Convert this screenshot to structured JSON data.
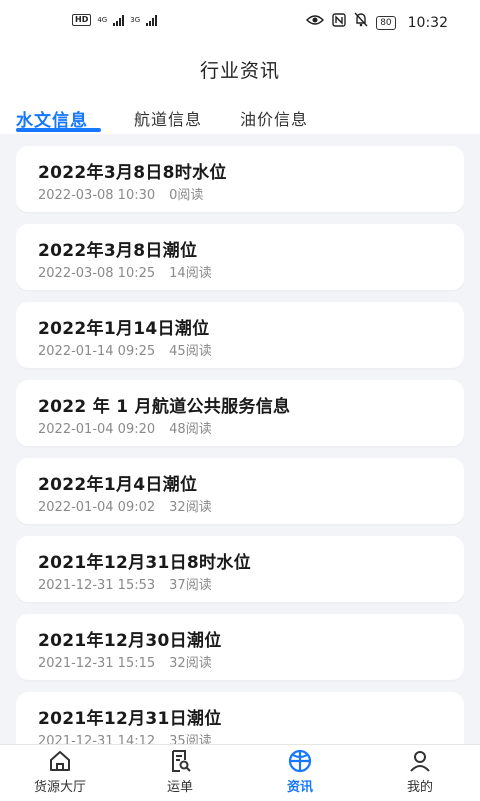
{
  "status_bar": {
    "hd": "HD",
    "net1": "4G",
    "net2": "3G",
    "battery": "80",
    "time": "10:32"
  },
  "header": {
    "title": "行业资讯",
    "tabs": [
      "水文信息",
      "航道信息",
      "油价信息"
    ],
    "active_tab": 0,
    "accent_color": "#1677ff"
  },
  "articles": [
    {
      "title": "2022年3月8日8时水位",
      "time": "2022-03-08 10:30",
      "reads": "0阅读"
    },
    {
      "title": "2022年3月8日潮位",
      "time": "2022-03-08 10:25",
      "reads": "14阅读"
    },
    {
      "title": "2022年1月14日潮位",
      "time": "2022-01-14 09:25",
      "reads": "45阅读"
    },
    {
      "title": "2022 年 1 月航道公共服务信息",
      "time": "2022-01-04 09:20",
      "reads": "48阅读"
    },
    {
      "title": "2022年1月4日潮位",
      "time": "2022-01-04 09:02",
      "reads": "32阅读"
    },
    {
      "title": "2021年12月31日8时水位",
      "time": "2021-12-31 15:53",
      "reads": "37阅读"
    },
    {
      "title": "2021年12月30日潮位",
      "time": "2021-12-31 15:15",
      "reads": "32阅读"
    },
    {
      "title": "2021年12月31日潮位",
      "time": "2021-12-31 14:12",
      "reads": "35阅读"
    }
  ],
  "tabbar": [
    {
      "label": "货源大厅",
      "icon": "home-icon"
    },
    {
      "label": "运单",
      "icon": "document-search-icon"
    },
    {
      "label": "资讯",
      "icon": "news-globe-icon"
    },
    {
      "label": "我的",
      "icon": "person-icon"
    }
  ],
  "tabbar_active": 2
}
